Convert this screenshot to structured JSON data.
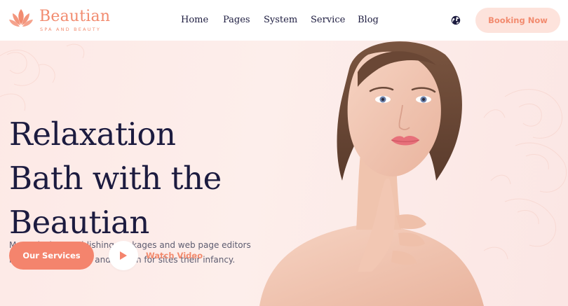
{
  "brand": {
    "name": "Beautian",
    "tagline": "SPA AND BEAUTY",
    "accent_color": "#f28b6f",
    "logo_icon": "lotus-icon"
  },
  "nav": {
    "items": [
      {
        "label": "Home"
      },
      {
        "label": "Pages"
      },
      {
        "label": "System"
      },
      {
        "label": "Service"
      },
      {
        "label": "Blog"
      }
    ],
    "language_icon": "globe-icon",
    "booking_label": "Booking Now"
  },
  "hero": {
    "title_lines": [
      "Relaxation",
      "Bath with the",
      "Beautian"
    ],
    "description": "Many desktop publishing packages and web page editors now use model text and search for sites their infancy.",
    "primary_cta": "Our Services",
    "video_icon": "play-icon",
    "video_label": "Watch Video",
    "title_color": "#1c1b3f",
    "background_color": "#fdeeeb",
    "image": "woman-portrait"
  }
}
